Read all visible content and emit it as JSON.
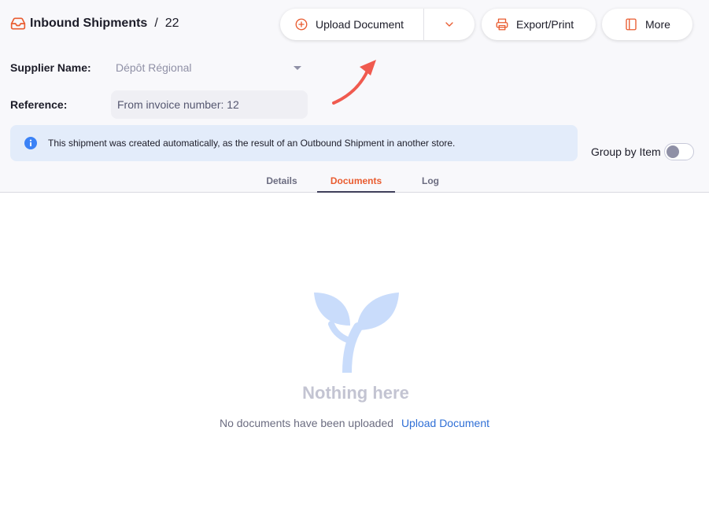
{
  "breadcrumb": {
    "title": "Inbound Shipments",
    "separator": "/",
    "number": "22"
  },
  "toolbar": {
    "upload_label": "Upload Document",
    "export_label": "Export/Print",
    "more_label": "More"
  },
  "fields": {
    "supplier_label": "Supplier Name:",
    "supplier_value": "Dépôt Régional",
    "reference_label": "Reference:",
    "reference_value": "From invoice number: 12"
  },
  "banner": {
    "text": "This shipment was created automatically, as the result of an Outbound Shipment in another store."
  },
  "group_by": {
    "label": "Group by Item",
    "enabled": false
  },
  "tabs": [
    {
      "label": "Details",
      "active": false
    },
    {
      "label": "Documents",
      "active": true
    },
    {
      "label": "Log",
      "active": false
    }
  ],
  "empty_state": {
    "title": "Nothing here",
    "message": "No documents have been uploaded",
    "action_label": "Upload Document"
  },
  "colors": {
    "accent": "#e95c30",
    "link": "#2f6fd6",
    "banner_bg": "#e3ecfa",
    "plant": "#c9dcfb",
    "annotation_arrow": "#f05a4f"
  },
  "icons": [
    "inbox-icon",
    "plus-circle-icon",
    "chevron-down-icon",
    "printer-icon",
    "sidebar-icon",
    "info-icon",
    "sprout-icon"
  ]
}
